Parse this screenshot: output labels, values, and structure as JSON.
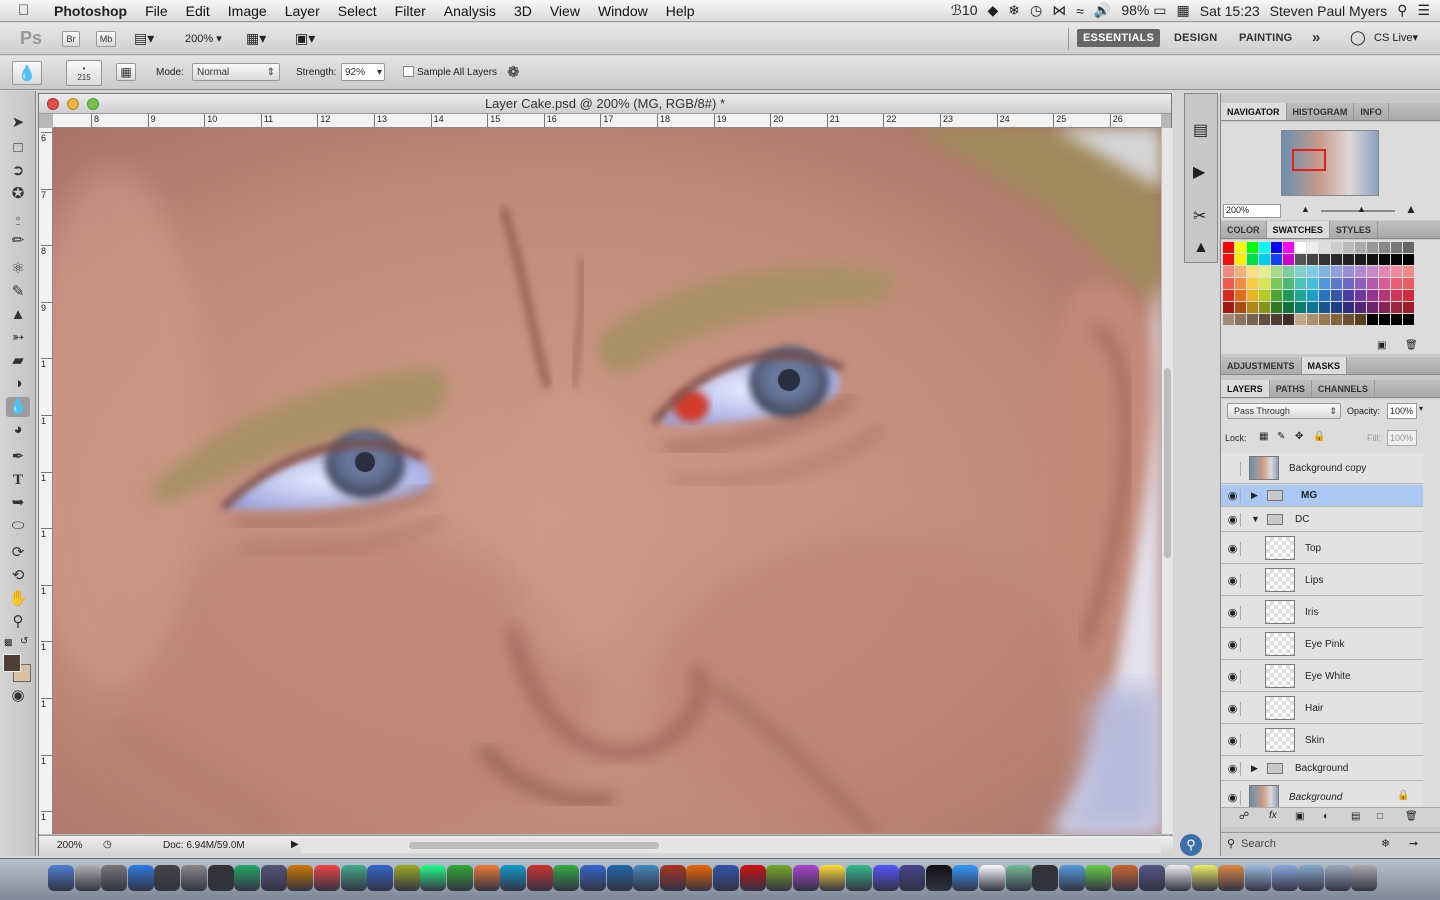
{
  "menubar": {
    "app": "Photoshop",
    "items": [
      "File",
      "Edit",
      "Image",
      "Layer",
      "Select",
      "Filter",
      "Analysis",
      "3D",
      "View",
      "Window",
      "Help"
    ],
    "status": {
      "adobe_count": "10",
      "battery": "98%",
      "clock": "Sat 15:23",
      "user": "Steven Paul Myers"
    }
  },
  "appbar": {
    "ps_logo": "Ps",
    "br": "Br",
    "mb": "Mb",
    "zoom": "200%",
    "workspaces": [
      "ESSENTIALS",
      "DESIGN",
      "PAINTING"
    ],
    "more": "»",
    "cslive": "CS Live"
  },
  "options": {
    "brush_size": "215",
    "mode_label": "Mode:",
    "mode_value": "Normal",
    "strength_label": "Strength:",
    "strength_value": "92%",
    "sample_all_layers": "Sample All Layers"
  },
  "document": {
    "title": "Layer Cake.psd @ 200% (MG, RGB/8#) *",
    "ruler_marks": [
      "8",
      "9",
      "10",
      "11",
      "12",
      "13",
      "14",
      "15",
      "16",
      "17",
      "18",
      "19",
      "20",
      "21",
      "22",
      "23",
      "24",
      "25",
      "26"
    ],
    "vruler_marks": [
      "6",
      "7",
      "8",
      "9",
      "1",
      "1",
      "1",
      "1",
      "1",
      "1",
      "1",
      "1",
      "1",
      "1"
    ],
    "zoom": "200%",
    "doc_size": "Doc: 6.94M/59.0M"
  },
  "navigator": {
    "tabs": [
      "NAVIGATOR",
      "HISTOGRAM",
      "INFO"
    ],
    "zoom": "200%"
  },
  "color_panel": {
    "tabs": [
      "COLOR",
      "SWATCHES",
      "STYLES"
    ]
  },
  "adjust_panel": {
    "tabs": [
      "ADJUSTMENTS",
      "MASKS"
    ]
  },
  "layers_panel": {
    "tabs": [
      "LAYERS",
      "PATHS",
      "CHANNELS"
    ],
    "blend": "Pass Through",
    "opacity_label": "Opacity:",
    "opacity": "100%",
    "lock_label": "Lock:",
    "fill_label": "Fill:",
    "fill": "100%",
    "layers": [
      {
        "name": "Background copy",
        "type": "image",
        "visible": false
      },
      {
        "name": "MG",
        "type": "group-closed",
        "visible": true,
        "selected": true
      },
      {
        "name": "DC",
        "type": "group-open",
        "visible": true
      },
      {
        "name": "Top",
        "type": "child",
        "visible": true
      },
      {
        "name": "Lips",
        "type": "child",
        "visible": true
      },
      {
        "name": "Iris",
        "type": "child",
        "visible": true
      },
      {
        "name": "Eye Pink",
        "type": "child",
        "visible": true
      },
      {
        "name": "Eye White",
        "type": "child",
        "visible": true
      },
      {
        "name": "Hair",
        "type": "child",
        "visible": true
      },
      {
        "name": "Skin",
        "type": "child",
        "visible": true
      },
      {
        "name": "Background",
        "type": "group-closed",
        "visible": true
      },
      {
        "name": "Background",
        "type": "image-locked",
        "visible": true
      }
    ]
  },
  "search": {
    "placeholder": "Search"
  },
  "colors": {
    "selection": "#aac8f2",
    "skin": "#c48e7e"
  }
}
